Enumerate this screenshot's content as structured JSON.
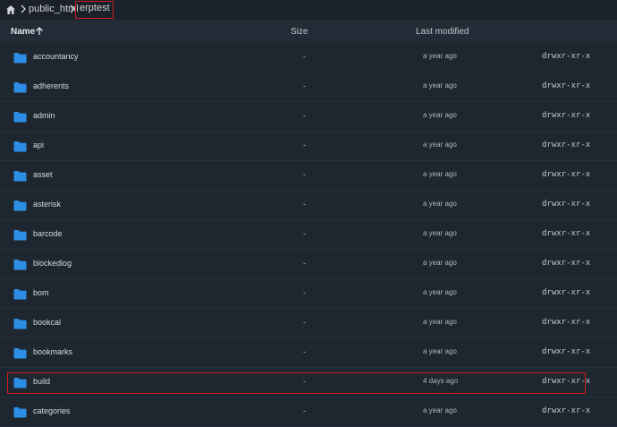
{
  "breadcrumb": {
    "home_icon": "home-icon",
    "items": [
      "public_html",
      "erptest"
    ]
  },
  "header": {
    "name": "Name",
    "size": "Size",
    "last_modified": "Last modified",
    "sort_icon": "arrow-up-icon"
  },
  "colors": {
    "folder": "#2d8ee6",
    "highlight": "#d1191f",
    "background": "#1c252e"
  },
  "files": [
    {
      "name": "accountancy",
      "size": "-",
      "modified": "a year ago",
      "perm": "drwxr-xr-x"
    },
    {
      "name": "adherents",
      "size": "-",
      "modified": "a year ago",
      "perm": "drwxr-xr-x"
    },
    {
      "name": "admin",
      "size": "-",
      "modified": "a year ago",
      "perm": "drwxr-xr-x"
    },
    {
      "name": "api",
      "size": "-",
      "modified": "a year ago",
      "perm": "drwxr-xr-x"
    },
    {
      "name": "asset",
      "size": "-",
      "modified": "a year ago",
      "perm": "drwxr-xr-x"
    },
    {
      "name": "asterisk",
      "size": "-",
      "modified": "a year ago",
      "perm": "drwxr-xr-x"
    },
    {
      "name": "barcode",
      "size": "-",
      "modified": "a year ago",
      "perm": "drwxr-xr-x"
    },
    {
      "name": "blockedlog",
      "size": "-",
      "modified": "a year ago",
      "perm": "drwxr-xr-x"
    },
    {
      "name": "bom",
      "size": "-",
      "modified": "a year ago",
      "perm": "drwxr-xr-x"
    },
    {
      "name": "bookcal",
      "size": "-",
      "modified": "a year ago",
      "perm": "drwxr-xr-x"
    },
    {
      "name": "bookmarks",
      "size": "-",
      "modified": "a year ago",
      "perm": "drwxr-xr-x"
    },
    {
      "name": "build",
      "size": "-",
      "modified": "4 days ago",
      "perm": "drwxr-xr-x"
    },
    {
      "name": "categories",
      "size": "-",
      "modified": "a year ago",
      "perm": "drwxr-xr-x"
    }
  ]
}
